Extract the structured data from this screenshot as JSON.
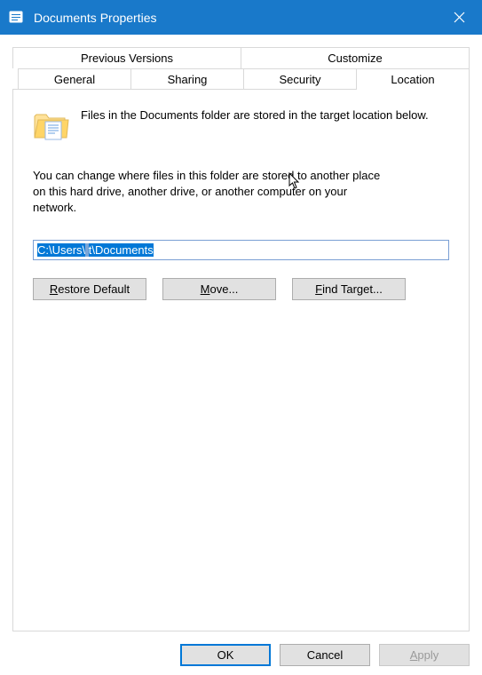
{
  "window": {
    "title": "Documents Properties"
  },
  "tabs": {
    "row1": [
      "Previous Versions",
      "Customize"
    ],
    "row2": [
      "General",
      "Sharing",
      "Security",
      "Location"
    ],
    "active": "Location"
  },
  "location_tab": {
    "intro": "Files in the Documents folder are stored in the target location below.",
    "para": "You can change where files in this folder are stored to another place on this hard drive, another drive, or another computer on your network.",
    "path_prefix": "C:\\Users\\",
    "path_obscured": "    ",
    "path_suffix": "t\\Documents",
    "buttons": {
      "restore": "Restore Default",
      "move": "Move...",
      "find": "Find Target..."
    }
  },
  "dialog_buttons": {
    "ok": "OK",
    "cancel": "Cancel",
    "apply": "Apply"
  }
}
